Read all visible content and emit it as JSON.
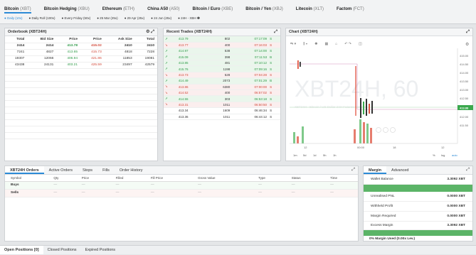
{
  "top_tabs": [
    {
      "name": "Bitcoin",
      "sym": "(XBT)"
    },
    {
      "name": "Bitcoin Hedging",
      "sym": "(XBU)"
    },
    {
      "name": "Ethereum",
      "sym": "(ETH)"
    },
    {
      "name": "China A50",
      "sym": "(A50)"
    },
    {
      "name": "Bitcoin / Euro",
      "sym": "(XBE)"
    },
    {
      "name": "Bitcoin / Yen",
      "sym": "(XBJ)"
    },
    {
      "name": "Litecoin",
      "sym": "(XLT)"
    },
    {
      "name": "Factom",
      "sym": "(FCT)"
    }
  ],
  "sub_tabs": [
    "Daily (10x)",
    "Daily Roll (100x)",
    "Every Friday (50x)",
    "25 Mar (25x)",
    "29 Apr (25x)",
    "24 Jun (25x)",
    "24H - XBH"
  ],
  "orderbook": {
    "title": "Orderbook (XBT24H)",
    "headers": [
      "Total",
      "Bid Size",
      "Price",
      "Price",
      "Ask Size",
      "Total"
    ],
    "rows": [
      [
        "2414",
        "2414",
        "413.78",
        "415.02",
        "2410",
        "2410"
      ],
      [
        "7241",
        "4827",
        "413.65",
        "415.73",
        "4818",
        "7228"
      ],
      [
        "19307",
        "12066",
        "406.94",
        "421.86",
        "11853",
        "19081"
      ],
      [
        "43438",
        "24131",
        "403.21",
        "425.59",
        "23497",
        "42579"
      ]
    ]
  },
  "recent_trades": {
    "title": "Recent Trades (XBT24H)",
    "rows": [
      {
        "dir": "up",
        "price": "413.79",
        "size": "802",
        "time": "07:17:09",
        "side": "S",
        "cls": "g"
      },
      {
        "dir": "down",
        "price": "413.77",
        "size": "400",
        "time": "07:16:03",
        "side": "S",
        "cls": "r"
      },
      {
        "dir": "up",
        "price": "414.97",
        "size": "538",
        "time": "07:14:00",
        "side": "S",
        "cls": "g"
      },
      {
        "dir": "up",
        "price": "415.09",
        "size": "398",
        "time": "07:11:53",
        "side": "B",
        "cls": "g"
      },
      {
        "dir": "up",
        "price": "413.85",
        "size": "481",
        "time": "07:10:12",
        "side": "S",
        "cls": "g"
      },
      {
        "dir": "up",
        "price": "415.76",
        "size": "1198",
        "time": "07:09:16",
        "side": "S",
        "cls": "g"
      },
      {
        "dir": "down",
        "price": "413.73",
        "size": "528",
        "time": "07:04:28",
        "side": "S",
        "cls": "r"
      },
      {
        "dir": "up",
        "price": "414.49",
        "size": "2073",
        "time": "07:01:29",
        "side": "B",
        "cls": "g"
      },
      {
        "dir": "down",
        "price": "413.86",
        "size": "6380",
        "time": "07:00:00",
        "side": "S",
        "cls": "r"
      },
      {
        "dir": "down",
        "price": "414.52",
        "size": "400",
        "time": "06:57:02",
        "side": "S",
        "cls": "r"
      },
      {
        "dir": "up",
        "price": "414.55",
        "size": "303",
        "time": "06:53:18",
        "side": "S",
        "cls": "g"
      },
      {
        "dir": "down",
        "price": "413.31",
        "size": "1011",
        "time": "06:50:50",
        "side": "S",
        "cls": "r"
      },
      {
        "dir": "",
        "price": "413.34",
        "size": "1609",
        "time": "06:46:34",
        "side": "S",
        "cls": ""
      },
      {
        "dir": "",
        "price": "413.36",
        "size": "1011",
        "time": "06:44:12",
        "side": "S",
        "cls": ""
      }
    ]
  },
  "chart": {
    "title": "Chart (XBT24H)",
    "watermark": "XBT24H, 60",
    "watermark_sub": "XBT24H · Bitcoin / US Dollar 24H Futures Contract",
    "price_labels": [
      "415.00",
      "414.50",
      "414.00",
      "413.50",
      "413.00",
      "412.50",
      "412.00",
      "411.50"
    ],
    "current_price": "413.88",
    "time_labels": [
      "12",
      "00:00",
      "18",
      "12"
    ],
    "range_buttons": [
      "1m",
      "5d",
      "1d",
      "5h",
      "1h"
    ],
    "right_buttons": [
      "%",
      "log",
      "auto"
    ]
  },
  "orders": {
    "tabs": [
      "XBT24H Orders",
      "Active Orders",
      "Stops",
      "Fills",
      "Order History"
    ],
    "headers": [
      "Symbol",
      "Qty",
      "Price",
      "Filled",
      "Fill Price",
      "Gross Value",
      "Type",
      "Status",
      "Time"
    ],
    "rows": [
      [
        "Buys",
        "—",
        "—",
        "—",
        "—",
        "—",
        "—",
        "—",
        "—"
      ],
      [
        "Sells",
        "—",
        "—",
        "—",
        "—",
        "—",
        "—",
        "—",
        "—"
      ]
    ]
  },
  "margin": {
    "tabs": [
      "Margin",
      "Advanced"
    ],
    "rows": [
      {
        "label": "Wallet Balance",
        "value": "3.3092 XBT"
      },
      {
        "label": "Unrealised PNL",
        "value": "0.0000 XBT"
      },
      {
        "label": "Withheld Profit",
        "value": "0.0000 XBT"
      },
      {
        "label": "Margin Required",
        "value": "0.0000 XBT"
      },
      {
        "label": "Excess Margin",
        "value": "3.3092 XBT"
      }
    ],
    "used": "0% Margin Used (0.00x Lev.)"
  },
  "bottom_tabs": [
    "Open Positions [0]",
    "Closed Positions",
    "Expired Positions"
  ]
}
